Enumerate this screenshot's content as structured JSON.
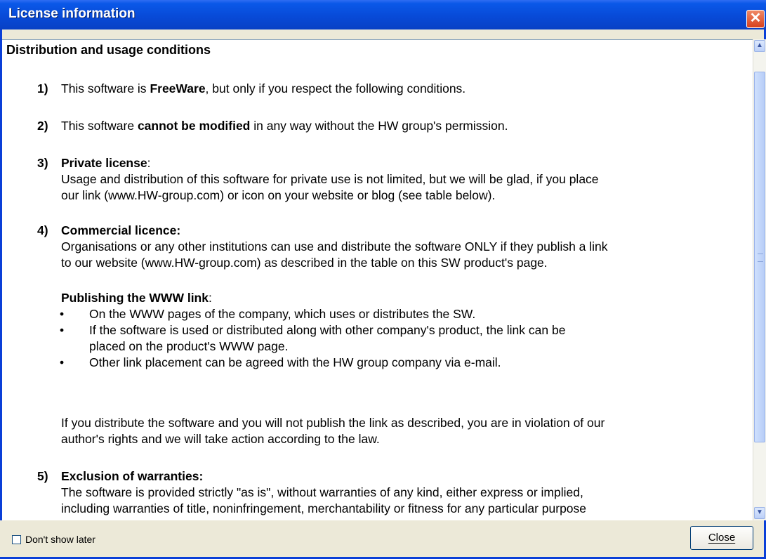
{
  "window": {
    "title": "License information",
    "close_glyph": "✕"
  },
  "content": {
    "heading": "Distribution and usage conditions",
    "items": [
      {
        "num": "1)",
        "pre": "This software is ",
        "bold": "FreeWare",
        "post": ", but only if you respect the following conditions."
      },
      {
        "num": "2)",
        "pre": "This software ",
        "bold": "cannot be modified",
        "post": " in any way without the HW group's permission."
      },
      {
        "num": "3)",
        "bold": "Private license",
        "post": ":",
        "body": [
          "Usage and distribution of this software for private use is not limited, but we will be glad, if you place",
          "our link (www.HW-group.com) or icon on your website or blog (see table below)."
        ]
      },
      {
        "num": "4)",
        "bold": "Commercial licence:",
        "body": [
          "Organisations or any other institutions can use and distribute the software ONLY if they publish a link",
          "to our website (www.HW-group.com) as described in the table on this SW product's page."
        ]
      },
      {
        "num": "5)",
        "bold": "Exclusion of warranties:",
        "body": [
          "The software is provided strictly \"as is\", without warranties of any kind, either express or implied,",
          "including warranties of title, noninfringement, merchantability or fitness for any particular purpose"
        ]
      }
    ],
    "publishing": {
      "bold": "Publishing the WWW link",
      "post": ":",
      "bullet_glyph": "•",
      "bullets": [
        [
          "On the WWW pages of the company, which uses or distributes the SW."
        ],
        [
          "If the software is used or distributed along with other company's product, the link can be",
          "placed on the product's WWW page."
        ],
        [
          "Other link placement can be agreed with the HW group company via e-mail."
        ]
      ]
    },
    "violation": [
      "If you distribute the software and you will not publish the link as described, you are in violation of our",
      "author's rights and we will take action according to the law."
    ]
  },
  "scrollbar": {
    "up_glyph": "▲",
    "down_glyph": "▼"
  },
  "footer": {
    "checkbox_label": "Don't show later",
    "checkbox_checked": false,
    "close_button_label": "Close"
  }
}
